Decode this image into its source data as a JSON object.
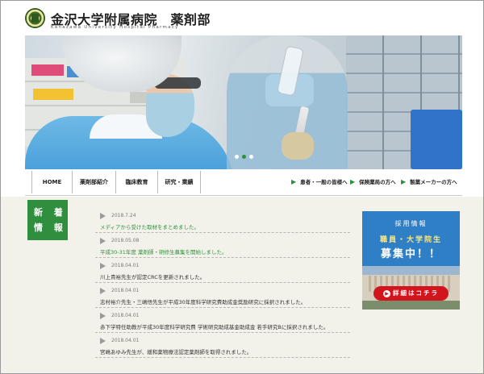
{
  "header": {
    "title": "金沢大学附属病院　薬剤部",
    "subtitle": "Kanazawa University Hospital Pharmacy"
  },
  "hero": {
    "slide_count": 3,
    "active_slide": 2
  },
  "nav": {
    "items": [
      {
        "label": "HOME"
      },
      {
        "label": "薬剤部紹介"
      },
      {
        "label": "臨床教育"
      },
      {
        "label": "研究・業績"
      }
    ],
    "links": [
      {
        "label": "患者・一般の皆様へ"
      },
      {
        "label": "保険薬局の方へ"
      },
      {
        "label": "製薬メーカーの方へ"
      }
    ]
  },
  "news": {
    "label_line1": "新 着",
    "label_line2": "情 報",
    "items": [
      {
        "date": "2018.7.24",
        "title": "メディアから受けた取材をまとめました。",
        "highlight": true
      },
      {
        "date": "2018.05.08",
        "title": "平成30-31年度 薬剤師・研修生募集を開始しました。",
        "highlight": true
      },
      {
        "date": "2018.04.01",
        "title": "川上貴裕先生が認定CRCを更新されました。",
        "highlight": false
      },
      {
        "date": "2018.04.01",
        "title": "志村裕介先生・三嶋悟先生が平成30年度科学研究費助成金奨励研究に採択されました。",
        "highlight": false
      },
      {
        "date": "2018.04.01",
        "title": "赤下学特任助教が平成30年度科学研究費 学術研究助成基金助成金 若手研究Bに採択されました。",
        "highlight": false
      },
      {
        "date": "2018.04.01",
        "title": "宮嶋あゆみ先生が、緩和薬物療法認定薬剤師を取得されました。",
        "highlight": false
      }
    ]
  },
  "recruit": {
    "heading": "採用情報",
    "line2": "職員・大学院生",
    "line3": "募集中！！",
    "button_label": "詳細はコチラ",
    "button_icon": "▶"
  },
  "colors": {
    "brand_green": "#2f8f3e",
    "recruit_blue": "#2f7fc6",
    "button_red": "#d2141d"
  }
}
